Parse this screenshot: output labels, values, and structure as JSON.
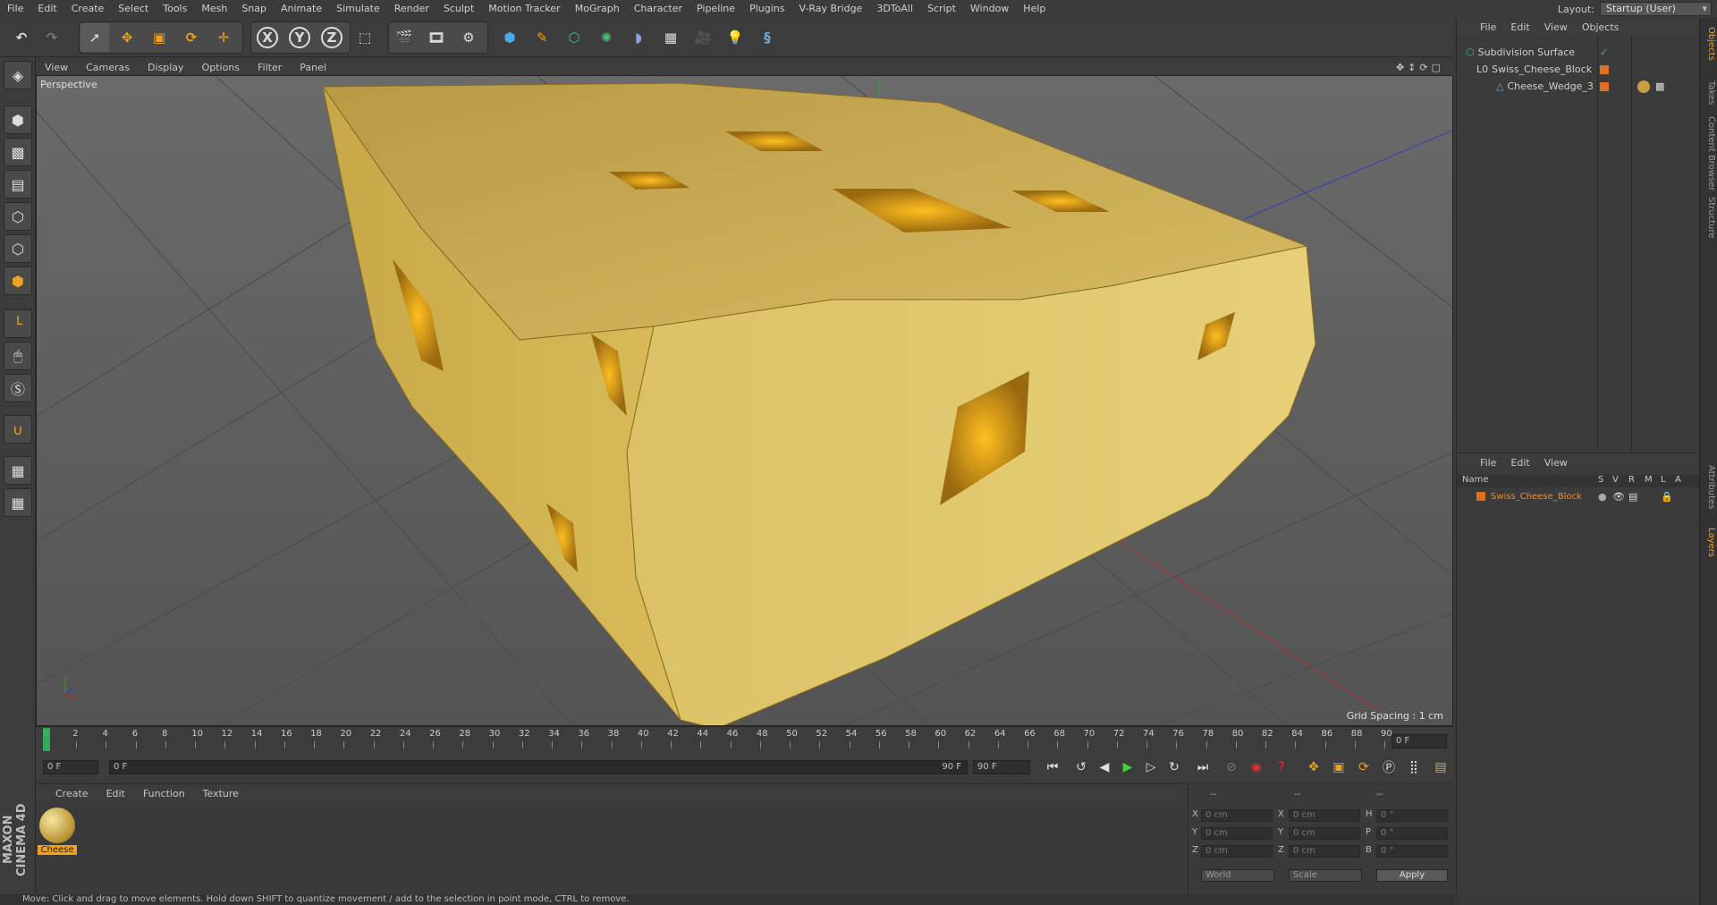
{
  "menubar": {
    "items": [
      "File",
      "Edit",
      "Create",
      "Select",
      "Tools",
      "Mesh",
      "Snap",
      "Animate",
      "Simulate",
      "Render",
      "Sculpt",
      "Motion Tracker",
      "MoGraph",
      "Character",
      "Pipeline",
      "Plugins",
      "V-Ray Bridge",
      "3DToAll",
      "Script",
      "Window",
      "Help"
    ],
    "layout_label": "Layout:",
    "layout_value": "Startup (User)"
  },
  "toolbar": {
    "axis_x": "X",
    "axis_y": "Y",
    "axis_z": "Z"
  },
  "viewport": {
    "menu": [
      "View",
      "Cameras",
      "Display",
      "Options",
      "Filter",
      "Panel"
    ],
    "label": "Perspective",
    "grid_spacing": "Grid Spacing : 1 cm"
  },
  "timeline": {
    "ticks": [
      "0",
      "2",
      "4",
      "6",
      "8",
      "10",
      "12",
      "14",
      "16",
      "18",
      "20",
      "22",
      "24",
      "26",
      "28",
      "30",
      "32",
      "34",
      "36",
      "38",
      "40",
      "42",
      "44",
      "46",
      "48",
      "50",
      "52",
      "54",
      "56",
      "58",
      "60",
      "62",
      "64",
      "66",
      "68",
      "70",
      "72",
      "74",
      "76",
      "78",
      "80",
      "82",
      "84",
      "86",
      "88",
      "90"
    ],
    "current_frame": "0 F"
  },
  "transport": {
    "start_field": "0 F",
    "range_start": "0 F",
    "range_end": "90 F",
    "end_field": "90 F"
  },
  "material": {
    "menu": [
      "Create",
      "Edit",
      "Function",
      "Texture"
    ],
    "items": [
      {
        "name": "Cheese"
      }
    ]
  },
  "coords": {
    "header": [
      "--",
      "--",
      "--"
    ],
    "rows": [
      {
        "l1": "X",
        "v1": "0 cm",
        "l2": "X",
        "v2": "0 cm",
        "l3": "H",
        "v3": "0 °"
      },
      {
        "l1": "Y",
        "v1": "0 cm",
        "l2": "Y",
        "v2": "0 cm",
        "l3": "P",
        "v3": "0 °"
      },
      {
        "l1": "Z",
        "v1": "0 cm",
        "l2": "Z",
        "v2": "0 cm",
        "l3": "B",
        "v3": "0 °"
      }
    ],
    "space": "World",
    "mode": "Scale",
    "apply": "Apply"
  },
  "objects": {
    "menu": [
      "File",
      "Edit",
      "View",
      "Objects"
    ],
    "items": [
      {
        "name": "Subdivision Surface"
      },
      {
        "name": "Swiss_Cheese_Block"
      },
      {
        "name": "Cheese_Wedge_3"
      }
    ]
  },
  "layers": {
    "menu": [
      "File",
      "Edit",
      "View"
    ],
    "header": {
      "name": "Name",
      "cols": [
        "S",
        "V",
        "R",
        "M",
        "L",
        "A"
      ]
    },
    "items": [
      {
        "name": "Swiss_Cheese_Block"
      }
    ]
  },
  "side_tabs": [
    "Objects",
    "Takes",
    "Content Browser",
    "Structure",
    "Attributes",
    "Layers"
  ],
  "brand": "MAXON CINEMA 4D",
  "status": "Move: Click and drag to move elements. Hold down SHIFT to quantize movement / add to the selection in point mode, CTRL to remove.",
  "colors": {
    "accent": "#f0a020",
    "cheese": "#d8b850",
    "layer_text": "#f08a30"
  }
}
